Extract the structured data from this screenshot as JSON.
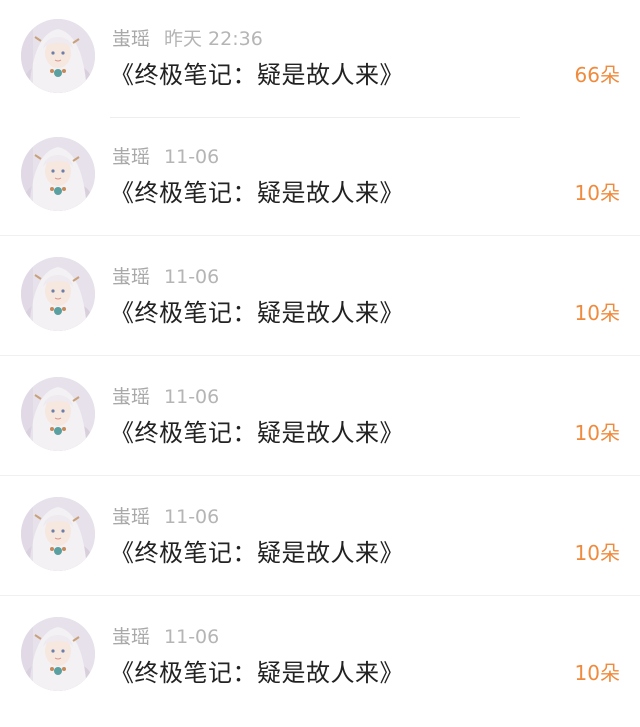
{
  "items": [
    {
      "name": "蚩瑶",
      "time": "昨天 22:36",
      "message": "《终极笔记：疑是故人来》",
      "amount": "66朵"
    },
    {
      "name": "蚩瑶",
      "time": "11-06",
      "message": "《终极笔记：疑是故人来》",
      "amount": "10朵"
    },
    {
      "name": "蚩瑶",
      "time": "11-06",
      "message": "《终极笔记：疑是故人来》",
      "amount": "10朵"
    },
    {
      "name": "蚩瑶",
      "time": "11-06",
      "message": "《终极笔记：疑是故人来》",
      "amount": "10朵"
    },
    {
      "name": "蚩瑶",
      "time": "11-06",
      "message": "《终极笔记：疑是故人来》",
      "amount": "10朵"
    },
    {
      "name": "蚩瑶",
      "time": "11-06",
      "message": "《终极笔记：疑是故人来》",
      "amount": "10朵"
    }
  ],
  "colors": {
    "amount": "#f08a3c",
    "name": "#a9a9a9",
    "message": "#222222"
  }
}
